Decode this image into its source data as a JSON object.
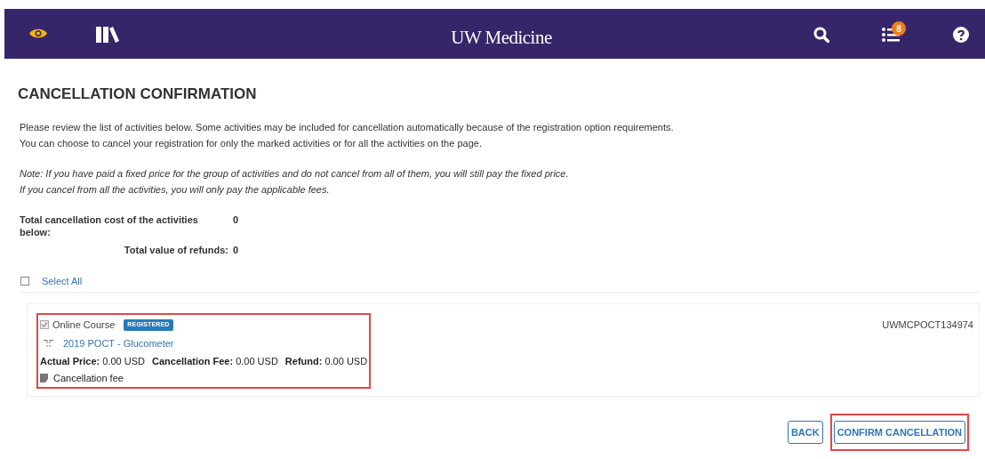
{
  "header": {
    "title": "UW Medicine",
    "notification_count": "8"
  },
  "heading": "CANCELLATION CONFIRMATION",
  "intro": [
    "Please review the list of activities below. Some activities may be included for cancellation automatically because of the registration option requirements.",
    "You can choose to cancel your registration for only the marked activities or for all the activities on the page."
  ],
  "note": [
    "Note: If you have paid a fixed price for the group of activities and do not cancel from all of them, you will still pay the fixed price.",
    "If you cancel from all the activities, you will only pay the applicable fees."
  ],
  "totals": [
    {
      "label": "Total cancellation cost of the activities below:",
      "value": "0"
    },
    {
      "label": "Total value of refunds:",
      "value": "0"
    }
  ],
  "select_all": {
    "label": "Select All",
    "checked": false
  },
  "activities": [
    {
      "type": "Online Course",
      "checked": true,
      "disabled": true,
      "status": "REGISTERED",
      "title": "2019 POCT - Glucometer",
      "code": "UWMCPOCT134974",
      "highlighted": true,
      "prices": [
        {
          "label": "Actual Price:",
          "value": "0.00 USD"
        },
        {
          "label": "Cancellation Fee:",
          "value": "0.00 USD"
        },
        {
          "label": "Refund:",
          "value": "0.00 USD"
        }
      ],
      "fee_note": "Cancellation fee"
    }
  ],
  "buttons": [
    {
      "label": "BACK",
      "highlighted": false
    },
    {
      "label": "CONFIRM CANCELLATION",
      "highlighted": true
    }
  ]
}
